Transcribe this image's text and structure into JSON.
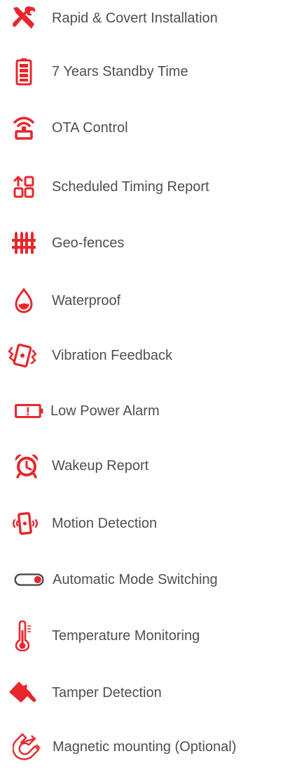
{
  "accent_color": "#e8262d",
  "features": [
    {
      "label": "Rapid & Covert Installation",
      "icon": "tools-icon"
    },
    {
      "label": "7 Years Standby Time",
      "icon": "battery-icon"
    },
    {
      "label": "OTA Control",
      "icon": "wireless-router-icon"
    },
    {
      "label": "Scheduled Timing Report",
      "icon": "timer-report-icon"
    },
    {
      "label": "Geo-fences",
      "icon": "fence-icon"
    },
    {
      "label": "Waterproof",
      "icon": "water-drop-icon"
    },
    {
      "label": "Vibration Feedback",
      "icon": "vibration-icon"
    },
    {
      "label": "Low Power Alarm",
      "icon": "low-battery-alert-icon"
    },
    {
      "label": "Wakeup Report",
      "icon": "alarm-clock-icon"
    },
    {
      "label": "Motion Detection",
      "icon": "motion-sensor-icon"
    },
    {
      "label": "Automatic Mode Switching",
      "icon": "toggle-switch-icon"
    },
    {
      "label": "Temperature Monitoring",
      "icon": "thermometer-icon"
    },
    {
      "label": "Tamper Detection",
      "icon": "hammer-icon"
    },
    {
      "label": "Magnetic mounting (Optional)",
      "icon": "magnet-icon"
    }
  ]
}
